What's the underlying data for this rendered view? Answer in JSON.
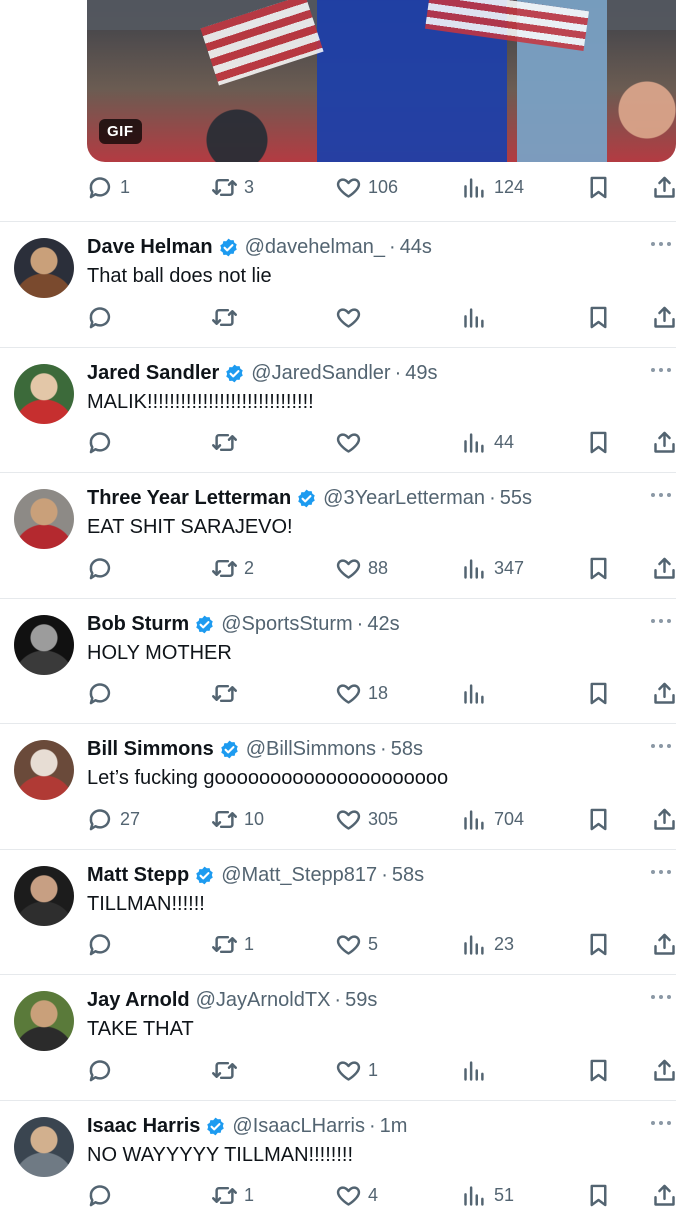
{
  "media": {
    "badge": "GIF"
  },
  "top_tweet": {
    "reply": "1",
    "retweet": "3",
    "like": "106",
    "views": "124"
  },
  "tweets": [
    {
      "name": "Dave Helman",
      "verified": true,
      "handle": "@davehelman_",
      "time": "44s",
      "text": "That ball does not lie",
      "reply": "",
      "retweet": "",
      "like": "",
      "views": "",
      "avatar_colors": [
        "#2b2f3a",
        "#7a4a2e",
        "#c9a07a"
      ]
    },
    {
      "name": "Jared Sandler",
      "verified": true,
      "handle": "@JaredSandler",
      "time": "49s",
      "text": "MALIK!!!!!!!!!!!!!!!!!!!!!!!!!!!!!!",
      "reply": "",
      "retweet": "",
      "like": "",
      "views": "44",
      "avatar_colors": [
        "#3c6a3a",
        "#c62f2f",
        "#e3c7a8"
      ]
    },
    {
      "name": "Three Year Letterman",
      "verified": true,
      "handle": "@3YearLetterman",
      "time": "55s",
      "text": "EAT SHIT SARAJEVO!",
      "reply": "",
      "retweet": "2",
      "like": "88",
      "views": "347",
      "avatar_colors": [
        "#8d8a86",
        "#b4292f",
        "#c9a07a"
      ]
    },
    {
      "name": "Bob Sturm",
      "verified": true,
      "handle": "@SportsSturm",
      "time": "42s",
      "text": "HOLY MOTHER",
      "reply": "",
      "retweet": "",
      "like": "18",
      "views": "",
      "avatar_colors": [
        "#111111",
        "#3a3a3a",
        "#9c9c9c"
      ]
    },
    {
      "name": "Bill Simmons",
      "verified": true,
      "handle": "@BillSimmons",
      "time": "58s",
      "text": "Let’s fucking gooooooooooooooooooooo",
      "reply": "27",
      "retweet": "10",
      "like": "305",
      "views": "704",
      "avatar_colors": [
        "#6a4a3a",
        "#b03a35",
        "#e7ddd4"
      ]
    },
    {
      "name": "Matt Stepp",
      "verified": true,
      "handle": "@Matt_Stepp817",
      "time": "58s",
      "text": "TILLMAN!!!!!!",
      "reply": "",
      "retweet": "1",
      "like": "5",
      "views": "23",
      "avatar_colors": [
        "#1c1c1c",
        "#2e2e2e",
        "#c79f83"
      ]
    },
    {
      "name": "Jay Arnold",
      "verified": false,
      "handle": "@JayArnoldTX",
      "time": "59s",
      "text": "TAKE THAT",
      "reply": "",
      "retweet": "",
      "like": "1",
      "views": "",
      "avatar_colors": [
        "#5a7a3a",
        "#2b2b2b",
        "#c9a07a"
      ]
    },
    {
      "name": "Isaac Harris",
      "verified": true,
      "handle": "@IsaacLHarris",
      "time": "1m",
      "text": "NO WAYYYYY TILLMAN!!!!!!!!",
      "reply": "",
      "retweet": "1",
      "like": "4",
      "views": "51",
      "avatar_colors": [
        "#3a4550",
        "#6f7a84",
        "#d2b08e"
      ]
    }
  ]
}
